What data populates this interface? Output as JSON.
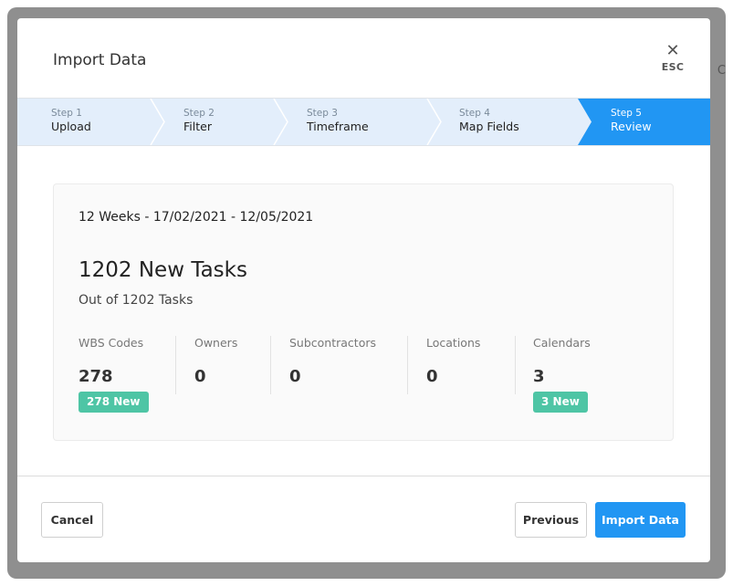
{
  "background": {
    "peek_text": "C"
  },
  "modal": {
    "title": "Import Data",
    "close": {
      "icon": "close-icon",
      "label": "ESC"
    }
  },
  "steps": [
    {
      "number": "Step 1",
      "name": "Upload",
      "active": false
    },
    {
      "number": "Step 2",
      "name": "Filter",
      "active": false
    },
    {
      "number": "Step 3",
      "name": "Timeframe",
      "active": false
    },
    {
      "number": "Step 4",
      "name": "Map Fields",
      "active": false
    },
    {
      "number": "Step 5",
      "name": "Review",
      "active": true
    }
  ],
  "summary": {
    "range": "12 Weeks - 17/02/2021 - 12/05/2021",
    "headline": "1202 New Tasks",
    "subline": "Out of 1202 Tasks",
    "stats": [
      {
        "label": "WBS Codes",
        "value": "278",
        "badge": "278 New"
      },
      {
        "label": "Owners",
        "value": "0",
        "badge": ""
      },
      {
        "label": "Subcontractors",
        "value": "0",
        "badge": ""
      },
      {
        "label": "Locations",
        "value": "0",
        "badge": ""
      },
      {
        "label": "Calendars",
        "value": "3",
        "badge": "3 New"
      }
    ]
  },
  "footer": {
    "cancel": "Cancel",
    "previous": "Previous",
    "import": "Import Data"
  },
  "colors": {
    "step_inactive": "#e3eefb",
    "step_active": "#2196f3",
    "badge": "#4ec5a5",
    "primary": "#2196f3"
  }
}
